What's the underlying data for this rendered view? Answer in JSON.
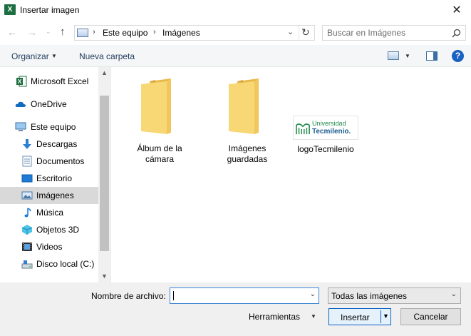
{
  "window": {
    "title": "Insertar imagen",
    "app_icon_letter": "X",
    "close_glyph": "✕"
  },
  "navigation": {
    "back_glyph": "←",
    "forward_glyph": "→",
    "recent_glyph": "⌄",
    "up_glyph": "↑",
    "breadcrumb": [
      "Este equipo",
      "Imágenes"
    ],
    "separator": "›",
    "search_placeholder": "Buscar en Imágenes"
  },
  "toolbar": {
    "organize_label": "Organizar",
    "new_folder_label": "Nueva carpeta",
    "help_glyph": "?"
  },
  "sidebar": {
    "items": [
      {
        "label": "Microsoft Excel",
        "icon": "excel-icon"
      },
      {
        "label": "OneDrive",
        "icon": "cloud-icon"
      },
      {
        "label": "Este equipo",
        "icon": "computer-icon"
      },
      {
        "label": "Descargas",
        "icon": "download-icon"
      },
      {
        "label": "Documentos",
        "icon": "document-icon"
      },
      {
        "label": "Escritorio",
        "icon": "desktop-icon"
      },
      {
        "label": "Imágenes",
        "icon": "pictures-icon",
        "selected": true
      },
      {
        "label": "Música",
        "icon": "music-icon"
      },
      {
        "label": "Objetos 3D",
        "icon": "cube-icon"
      },
      {
        "label": "Videos",
        "icon": "video-icon"
      },
      {
        "label": "Disco local (C:)",
        "icon": "drive-icon"
      }
    ]
  },
  "files": [
    {
      "name_line1": "Álbum de la",
      "name_line2": "cámara",
      "type": "folder"
    },
    {
      "name_line1": "Imágenes",
      "name_line2": "guardadas",
      "type": "folder"
    },
    {
      "name_line1": "logoTecmilenio",
      "name_line2": "",
      "type": "image",
      "logo_text_1": "Universidad",
      "logo_text_2": "Tecmilenio."
    }
  ],
  "footer": {
    "filename_label": "Nombre de archivo:",
    "filename_value": "",
    "file_type_value": "Todas las imágenes",
    "tools_label": "Herramientas",
    "insert_label": "Insertar",
    "cancel_label": "Cancelar"
  },
  "colors": {
    "excel_green": "#1d6f42",
    "folder_yellow": "#f8d775",
    "selection_gray": "#d9d9d9",
    "accent_blue": "#0a5fc2",
    "logo_green": "#1f8a4c"
  }
}
